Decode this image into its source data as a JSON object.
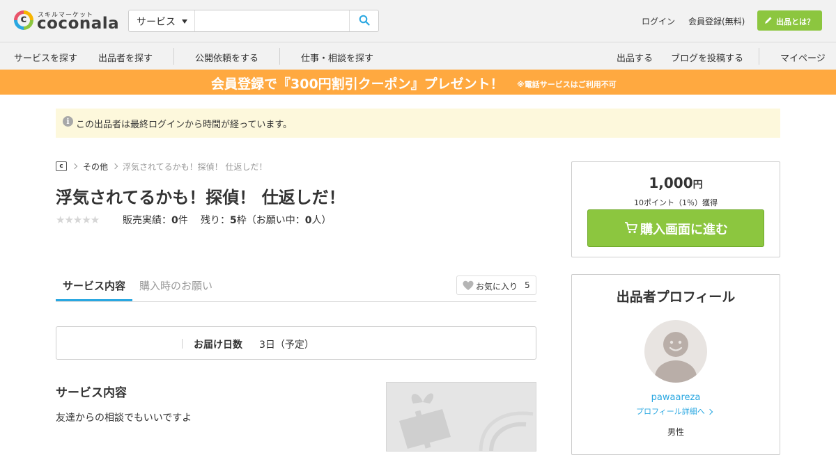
{
  "header": {
    "logo_sub": "スキルマーケット",
    "logo_text": "coconala",
    "logo_mark": "c",
    "search_category": "サービス",
    "search_value": "",
    "login": "ログイン",
    "register": "会員登録(無料)",
    "about": "出品とは？"
  },
  "nav": {
    "left": [
      "サービスを探す",
      "出品者を探す",
      "公開依頼をする",
      "仕事・相談を探す"
    ],
    "right": [
      "出品する",
      "ブログを投稿する",
      "マイページ"
    ]
  },
  "banner": {
    "main": "会員登録で『300円割引クーポン』プレゼント！",
    "note": "※電話サービスはご利用不可",
    "color": "#ffa940"
  },
  "notice": {
    "icon": "info-icon",
    "text": "この出品者は最終ログインから時間が経っています。"
  },
  "breadcrumb": {
    "home": "c",
    "category": "その他",
    "current": "浮気されてるかも！探偵！ 仕返しだ！"
  },
  "service": {
    "title": "浮気されてるかも！探偵！ 仕返しだ！",
    "rating_stars": 0,
    "stars_display": "★★★★★",
    "sales_label": "販売実績：",
    "sales_count": "0",
    "sales_unit": "件",
    "remaining_label": "残り：",
    "remaining_count": "5",
    "remaining_unit": "枠（お願い中：",
    "requesting_count": "0",
    "requesting_unit": "人）"
  },
  "tabs": {
    "active": "サービス内容",
    "inactive": "購入時のお願い",
    "favorite_label": "お気に入り",
    "favorite_count": "5"
  },
  "delivery": {
    "label": "お届け日数",
    "value": "3日（予定）"
  },
  "content": {
    "section_title": "サービス内容",
    "body": "友達からの相談でもいいですよ"
  },
  "purchase": {
    "price": "1,000",
    "currency": "円",
    "points": "10ポイント（1％）獲得",
    "buy_label": "購入画面に進む",
    "button_color": "#8cc63f"
  },
  "profile": {
    "title": "出品者プロフィール",
    "username": "pawaareza",
    "detail_link": "プロフィール詳細へ",
    "gender": "男性"
  },
  "colors": {
    "accent_green": "#8cc63f",
    "link_blue": "#29a7e1",
    "header_bg": "#f2f2f2",
    "notice_bg": "#fdf8dc"
  }
}
